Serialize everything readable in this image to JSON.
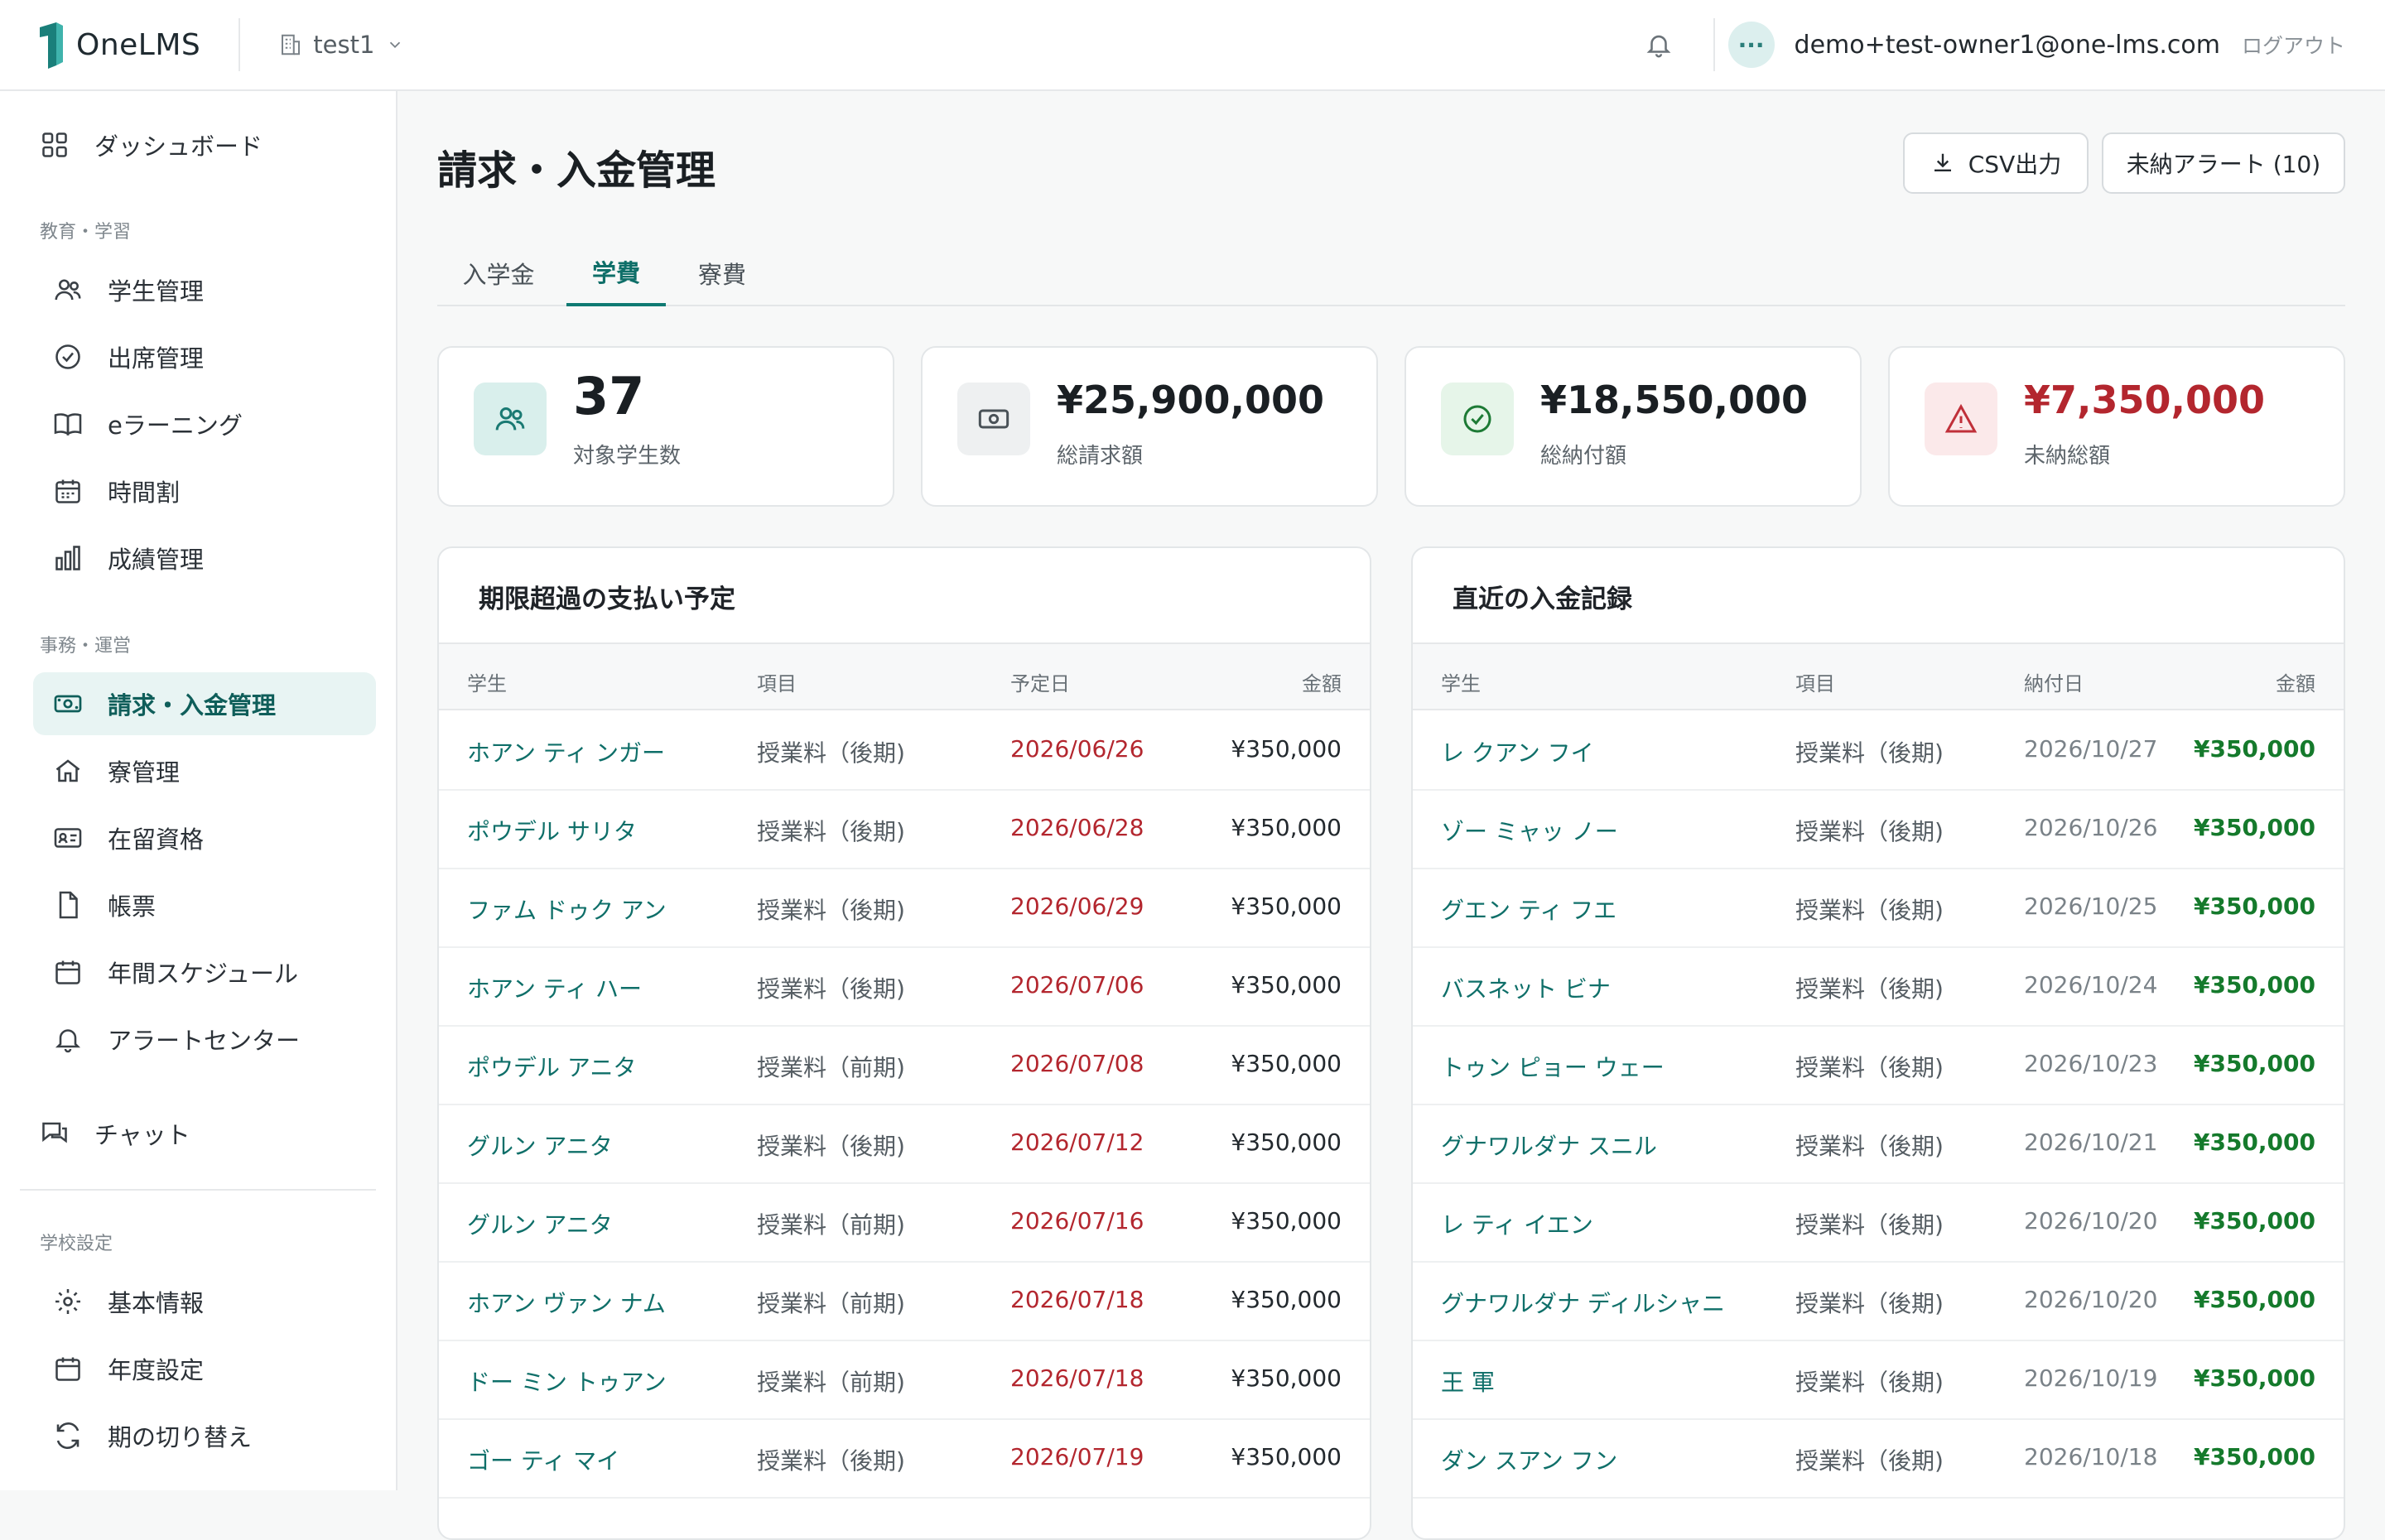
{
  "app": {
    "name": "OneLMS",
    "school": "test1",
    "user_email": "demo+test-owner1@one-lms.com",
    "logout_label": "ログアウト",
    "avatar_text": "···"
  },
  "sidebar": {
    "dashboard": "ダッシュボード",
    "section_education": "教育・学習",
    "education_items": [
      "学生管理",
      "出席管理",
      "eラーニング",
      "時間割",
      "成績管理"
    ],
    "section_admin": "事務・運営",
    "admin_items": [
      "請求・入金管理",
      "寮管理",
      "在留資格",
      "帳票",
      "年間スケジュール",
      "アラートセンター"
    ],
    "chat": "チャット",
    "section_settings": "学校設定",
    "settings_items": [
      "基本情報",
      "年度設定",
      "期の切り替え"
    ],
    "active_item": "請求・入金管理"
  },
  "page": {
    "title": "請求・入金管理",
    "csv_button": "CSV出力",
    "alert_button": "未納アラート (10)",
    "tabs": [
      "入学金",
      "学費",
      "寮費"
    ],
    "active_tab": "学費"
  },
  "stats": {
    "students": {
      "value": "37",
      "label": "対象学生数"
    },
    "billed": {
      "value": "¥25,900,000",
      "label": "総請求額"
    },
    "paid": {
      "value": "¥18,550,000",
      "label": "総納付額"
    },
    "unpaid": {
      "value": "¥7,350,000",
      "label": "未納総額"
    }
  },
  "colors": {
    "accent": "#0f6f69",
    "overdue": "#b3262e",
    "paid": "#157a2c",
    "unpaid_value": "#b3262e"
  },
  "overdue": {
    "title": "期限超過の支払い予定",
    "columns": [
      "学生",
      "項目",
      "予定日",
      "金額"
    ],
    "rows": [
      [
        "ホアン ティ ンガー",
        "授業料（後期)",
        "2026/06/26",
        "¥350,000"
      ],
      [
        "ポウデル サリタ",
        "授業料（後期)",
        "2026/06/28",
        "¥350,000"
      ],
      [
        "ファム ドゥク アン",
        "授業料（後期)",
        "2026/06/29",
        "¥350,000"
      ],
      [
        "ホアン ティ ハー",
        "授業料（後期)",
        "2026/07/06",
        "¥350,000"
      ],
      [
        "ポウデル アニタ",
        "授業料（前期)",
        "2026/07/08",
        "¥350,000"
      ],
      [
        "グルン アニタ",
        "授業料（後期)",
        "2026/07/12",
        "¥350,000"
      ],
      [
        "グルン アニタ",
        "授業料（前期)",
        "2026/07/16",
        "¥350,000"
      ],
      [
        "ホアン ヴァン ナム",
        "授業料（前期)",
        "2026/07/18",
        "¥350,000"
      ],
      [
        "ドー ミン トゥアン",
        "授業料（前期)",
        "2026/07/18",
        "¥350,000"
      ],
      [
        "ゴー ティ マイ",
        "授業料（後期)",
        "2026/07/19",
        "¥350,000"
      ]
    ]
  },
  "recent": {
    "title": "直近の入金記録",
    "columns": [
      "学生",
      "項目",
      "納付日",
      "金額"
    ],
    "rows": [
      [
        "レ クアン フイ",
        "授業料（後期)",
        "2026/10/27",
        "¥350,000"
      ],
      [
        "ゾー ミャッ ノー",
        "授業料（後期)",
        "2026/10/26",
        "¥350,000"
      ],
      [
        "グエン ティ フエ",
        "授業料（後期)",
        "2026/10/25",
        "¥350,000"
      ],
      [
        "バスネット ビナ",
        "授業料（後期)",
        "2026/10/24",
        "¥350,000"
      ],
      [
        "トゥン ピョー ウェー",
        "授業料（後期)",
        "2026/10/23",
        "¥350,000"
      ],
      [
        "グナワルダナ スニル",
        "授業料（後期)",
        "2026/10/21",
        "¥350,000"
      ],
      [
        "レ ティ イエン",
        "授業料（後期)",
        "2026/10/20",
        "¥350,000"
      ],
      [
        "グナワルダナ ディルシャニ",
        "授業料（後期)",
        "2026/10/20",
        "¥350,000"
      ],
      [
        "王 軍",
        "授業料（後期)",
        "2026/10/19",
        "¥350,000"
      ],
      [
        "ダン スアン フン",
        "授業料（後期)",
        "2026/10/18",
        "¥350,000"
      ]
    ]
  }
}
